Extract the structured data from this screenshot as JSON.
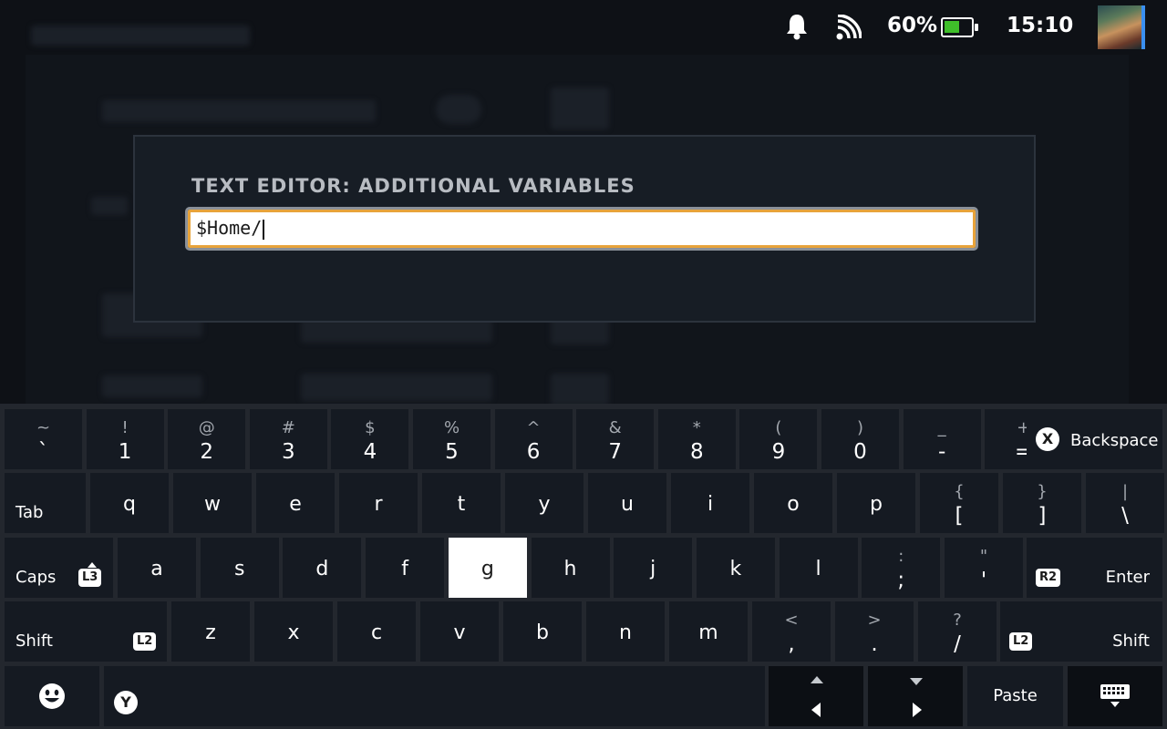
{
  "status": {
    "battery_pct": "60%",
    "battery_level": 0.6,
    "battery_color": "#3fbf2a",
    "time": "15:10",
    "icons": [
      "bell-icon",
      "signal-icon",
      "battery-icon",
      "avatar"
    ]
  },
  "dialog": {
    "title": "TEXT EDITOR: ADDITIONAL VARIABLES",
    "input_value": "$Home/"
  },
  "keyboard": {
    "row1": [
      {
        "shift": "~",
        "main": "`"
      },
      {
        "shift": "!",
        "main": "1"
      },
      {
        "shift": "@",
        "main": "2"
      },
      {
        "shift": "#",
        "main": "3"
      },
      {
        "shift": "$",
        "main": "4"
      },
      {
        "shift": "%",
        "main": "5"
      },
      {
        "shift": "^",
        "main": "6"
      },
      {
        "shift": "&",
        "main": "7"
      },
      {
        "shift": "*",
        "main": "8"
      },
      {
        "shift": "(",
        "main": "9"
      },
      {
        "shift": ")",
        "main": "0"
      },
      {
        "shift": "_",
        "main": "-"
      },
      {
        "shift": "+",
        "main": "="
      }
    ],
    "backspace": {
      "badge": "X",
      "label": "Backspace"
    },
    "tab": "Tab",
    "row2": [
      {
        "main": "q"
      },
      {
        "main": "w"
      },
      {
        "main": "e"
      },
      {
        "main": "r"
      },
      {
        "main": "t"
      },
      {
        "main": "y"
      },
      {
        "main": "u"
      },
      {
        "main": "i"
      },
      {
        "main": "o"
      },
      {
        "main": "p"
      },
      {
        "shift": "{",
        "main": "["
      },
      {
        "shift": "}",
        "main": "]"
      },
      {
        "shift": "|",
        "main": "\\"
      }
    ],
    "caps": {
      "label": "Caps",
      "badge": "L3"
    },
    "row3": [
      {
        "main": "a"
      },
      {
        "main": "s"
      },
      {
        "main": "d"
      },
      {
        "main": "f"
      },
      {
        "main": "g"
      },
      {
        "main": "h"
      },
      {
        "main": "j"
      },
      {
        "main": "k"
      },
      {
        "main": "l"
      },
      {
        "shift": ":",
        "main": ";"
      },
      {
        "shift": "\"",
        "main": "'"
      }
    ],
    "highlighted_key": "g",
    "enter": {
      "badge": "R2",
      "label": "Enter"
    },
    "shift_left": {
      "label": "Shift",
      "badge": "L2"
    },
    "row4": [
      {
        "main": "z"
      },
      {
        "main": "x"
      },
      {
        "main": "c"
      },
      {
        "main": "v"
      },
      {
        "main": "b"
      },
      {
        "main": "n"
      },
      {
        "main": "m"
      },
      {
        "shift": "<",
        "main": ","
      },
      {
        "shift": ">",
        "main": "."
      },
      {
        "shift": "?",
        "main": "/"
      }
    ],
    "shift_right": {
      "label": "Shift",
      "badge": "L2"
    },
    "space_badge": "Y",
    "paste": "Paste"
  }
}
